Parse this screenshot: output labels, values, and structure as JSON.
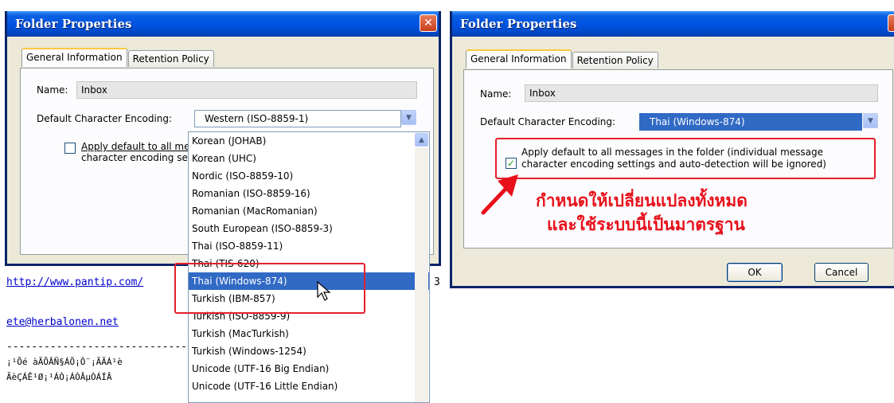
{
  "left_dialog": {
    "title": "Folder Properties",
    "close": "✕",
    "tabs": [
      "General Information",
      "Retention Policy"
    ],
    "name_label": "Name:",
    "name_value": "Inbox",
    "encoding_label": "Default Character Encoding:",
    "encoding_value": "Western (ISO-8859-1)",
    "apply_text_line1": "Apply default to all me",
    "apply_text_line2": "character encoding se"
  },
  "dropdown_list": {
    "items": [
      "Korean (JOHAB)",
      "Korean (UHC)",
      "Nordic (ISO-8859-10)",
      "Romanian (ISO-8859-16)",
      "Romanian (MacRomanian)",
      "South European (ISO-8859-3)",
      "Thai (ISO-8859-11)",
      "Thai (TIS-620)",
      "Thai (Windows-874)",
      "Turkish (IBM-857)",
      "Turkish (ISO-8859-9)",
      "Turkish (MacTurkish)",
      "Turkish (Windows-1254)",
      "Unicode (UTF-16 Big Endian)",
      "Unicode (UTF-16 Little Endian)"
    ],
    "selected_index": 8
  },
  "background_page": {
    "url_text": "http://www.pantip.com/",
    "url_tail": "3",
    "email_text": "ete@herbalonen.net",
    "dashes": "---------------------------------",
    "garbled_line1": "¡¹Õé àÃÕÂÑ§ÁÕ¡Ô¨¡ÃÃÁ¹è",
    "garbled_line2": "ÃèÇÁÊ¹Ø¡¹ÁÒ¡ÁÒÂµÒÁÍÂ"
  },
  "right_dialog": {
    "title": "Folder Properties",
    "tabs": [
      "General Information",
      "Retention Policy"
    ],
    "name_label": "Name:",
    "name_value": "Inbox",
    "encoding_label": "Default Character Encoding:",
    "encoding_value": "Thai (Windows-874)",
    "apply_line1": "Apply default to all messages in the folder (individual message",
    "apply_line2": "character encoding settings and auto-detection will be ignored)",
    "checkbox_checked": true,
    "annotation_line1": "กำหนดให้เปลี่ยนแปลงทั้งหมด",
    "annotation_line2": "และใช้ระบบนี้เป็นมาตรฐาน",
    "ok_label": "OK",
    "cancel_label": "Cancel"
  },
  "colors": {
    "titlebar": "#0054e3",
    "selection": "#316ac5",
    "annotation_red": "#e8101a",
    "dialog_bg": "#ece9d8"
  }
}
